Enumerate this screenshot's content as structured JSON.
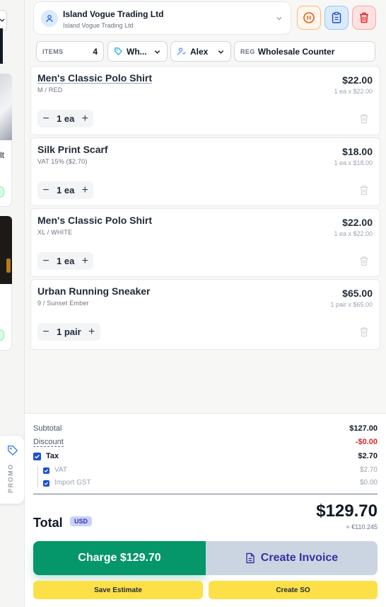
{
  "colors": {
    "accent_blue": "#1d4ed8",
    "charge_green": "#059669",
    "invoice_indigo": "#3730a3",
    "discount_red": "#dc2626",
    "yellow_button": "#fde047"
  },
  "left_strip": {
    "card1_text": "lt",
    "card2_text": ""
  },
  "promo": {
    "label": "PROMO",
    "icon": "tag-icon"
  },
  "customer": {
    "name": "Island Vogue Trading Ltd",
    "subtitle": "Island Vogue Trading Ltd",
    "icon": "user-icon"
  },
  "actions": {
    "pause_icon": "pause-icon",
    "clipboard_icon": "clipboard-icon",
    "delete_icon": "trash-icon"
  },
  "filters": {
    "items_label": "ITEMS",
    "items_count": "4",
    "price_list": "Wh...",
    "user": "Alex",
    "register_label": "REG",
    "register_value": "Wholesale Counter"
  },
  "cart": [
    {
      "name": "Men's Classic Polo Shirt",
      "variant": "M / RED",
      "price": "$22.00",
      "unit": "1 ea x $22.00",
      "qty": "1 ea"
    },
    {
      "name": "Silk Print Scarf",
      "variant": "VAT 15% ($2.70)",
      "price": "$18.00",
      "unit": "1 ea x $18.00",
      "qty": "1 ea"
    },
    {
      "name": "Men's Classic Polo Shirt",
      "variant": "XL / WHITE",
      "price": "$22.00",
      "unit": "1 ea x $22.00",
      "qty": "1 ea"
    },
    {
      "name": "Urban Running Sneaker",
      "variant": "9 / Sunset Ember",
      "price": "$65.00",
      "unit": "1 pair x $65.00",
      "qty": "1 pair"
    }
  ],
  "stepper": {
    "minus": "−",
    "plus": "+"
  },
  "totals": {
    "subtotal_label": "Subtotal",
    "subtotal_value": "$127.00",
    "discount_label": "Discount",
    "discount_value": "-$0.00",
    "tax_label": "Tax",
    "tax_value": "$2.70",
    "tax_lines": [
      {
        "label": "VAT",
        "value": "$2.70"
      },
      {
        "label": "Import GST",
        "value": "$0.00"
      }
    ],
    "total_label": "Total",
    "currency": "USD",
    "total_value": "$129.70",
    "converted": "≈ €110.245"
  },
  "buttons": {
    "charge": "Charge $129.70",
    "invoice": "Create Invoice",
    "save_estimate": "Save Estimate",
    "create_so": "Create SO"
  }
}
